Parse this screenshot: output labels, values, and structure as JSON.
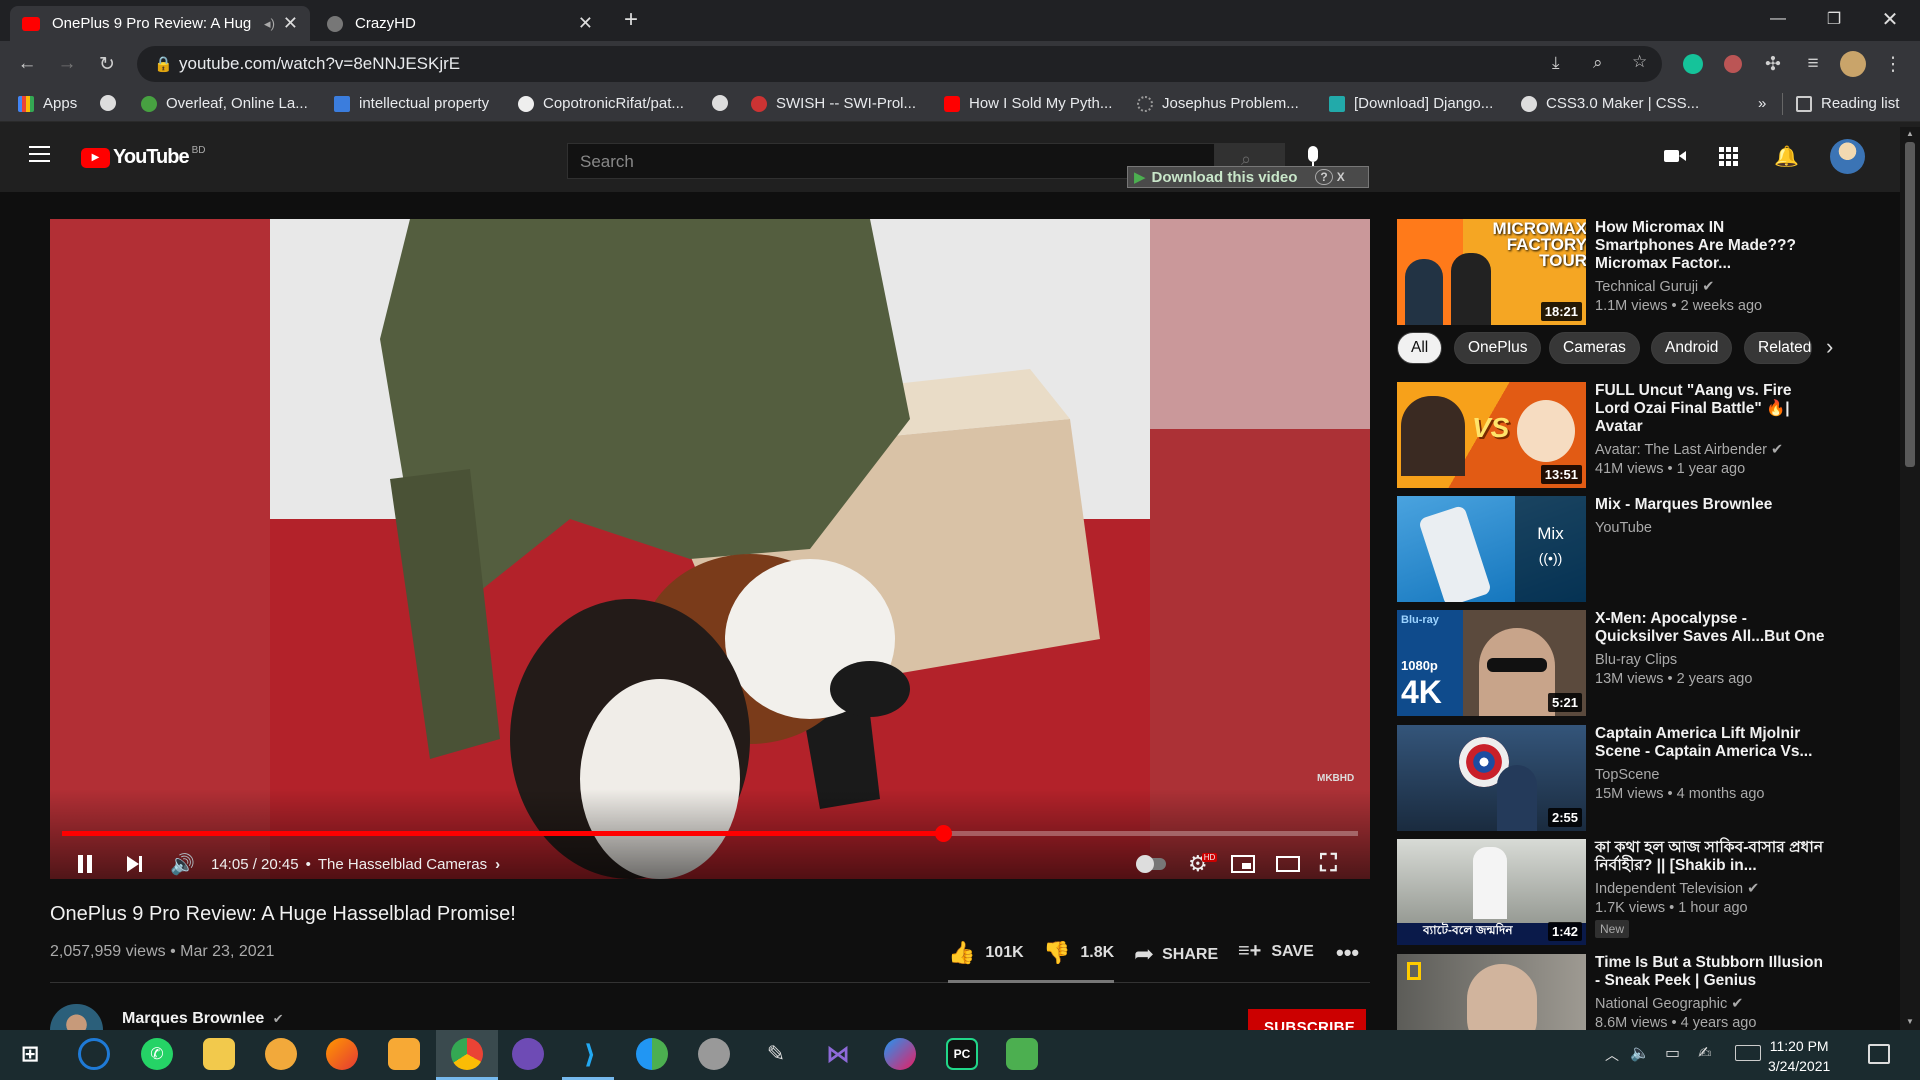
{
  "browser": {
    "tabs": [
      {
        "title": "OnePlus 9 Pro Review: A Hug",
        "active": true
      },
      {
        "title": "CrazyHD",
        "active": false
      }
    ],
    "url": "youtube.com/watch?v=8eNNJESKjrE",
    "bookmarks": [
      "Apps",
      "Overleaf, Online La...",
      "intellectual property",
      "CopotronicRifat/pat...",
      "SWISH -- SWI-Prol...",
      "How I Sold My Pyth...",
      "Josephus Problem...",
      "[Download] Django...",
      "CSS3.0 Maker | CSS..."
    ],
    "reading_list": "Reading list",
    "overflow": "»"
  },
  "youtube": {
    "logo": "YouTube",
    "region": "BD",
    "search_placeholder": "Search",
    "download_bar": "Download this video",
    "download_help": "?",
    "download_close": "X"
  },
  "player": {
    "time": "14:05 / 20:45",
    "separator": "•",
    "chapter": "The Hasselblad Cameras",
    "watermark": "MKBHD",
    "progress": 0.68,
    "buffered": 0.48,
    "colors": {
      "accent": "#ff0000"
    }
  },
  "video": {
    "title": "OnePlus 9 Pro Review: A Huge Hasselblad Promise!",
    "views": "2,057,959 views",
    "date": "Mar 23, 2021",
    "likes": "101K",
    "dislikes": "1.8K",
    "share": "SHARE",
    "save": "SAVE",
    "channel": "Marques Brownlee",
    "subscribe": "SUBSCRIBE"
  },
  "chips": [
    "All",
    "OnePlus",
    "Cameras",
    "Android",
    "Related"
  ],
  "recommendations": [
    {
      "title": "How Micromax IN Smartphones Are Made??? Micromax Factor...",
      "channel": "Technical Guruji",
      "meta": "1.1M views • 2 weeks ago",
      "duration": "18:21",
      "thumb_text": "MICROMAX FACTORY TOUR",
      "verified": true
    },
    {
      "title": "FULL Uncut \"Aang vs. Fire Lord Ozai Final Battle\" 🔥| Avatar",
      "channel": "Avatar: The Last Airbender",
      "meta": "41M views • 1 year ago",
      "duration": "13:51",
      "thumb_text": "VS",
      "verified": true
    },
    {
      "title": "Mix - Marques Brownlee",
      "channel": "YouTube",
      "meta": "",
      "duration": "",
      "thumb_text": "Mix",
      "verified": false
    },
    {
      "title": "X-Men: Apocalypse - Quicksilver Saves All...But One",
      "channel": "Blu-ray Clips",
      "meta": "13M views • 2 years ago",
      "duration": "5:21",
      "thumb_text": "4K",
      "verified": false
    },
    {
      "title": "Captain America Lift Mjolnir Scene - Captain America Vs...",
      "channel": "TopScene",
      "meta": "15M views • 4 months ago",
      "duration": "2:55",
      "thumb_text": "",
      "verified": false
    },
    {
      "title": "কা কথা হল আজ সাকিব-বাসার প্রধান নির্বাহীর? || [Shakib in...",
      "channel": "Independent Television",
      "meta": "1.7K views • 1 hour ago",
      "duration": "1:42",
      "badge": "New",
      "thumb_text": "ব্যাটে-বলে জন্মদিন",
      "verified": true
    },
    {
      "title": "Time Is But a Stubborn Illusion - Sneak Peek | Genius",
      "channel": "National Geographic",
      "meta": "8.6M views • 4 years ago",
      "duration": "",
      "thumb_text": "",
      "verified": true
    }
  ],
  "taskbar": {
    "time": "11:20 PM",
    "date": "3/24/2021"
  }
}
